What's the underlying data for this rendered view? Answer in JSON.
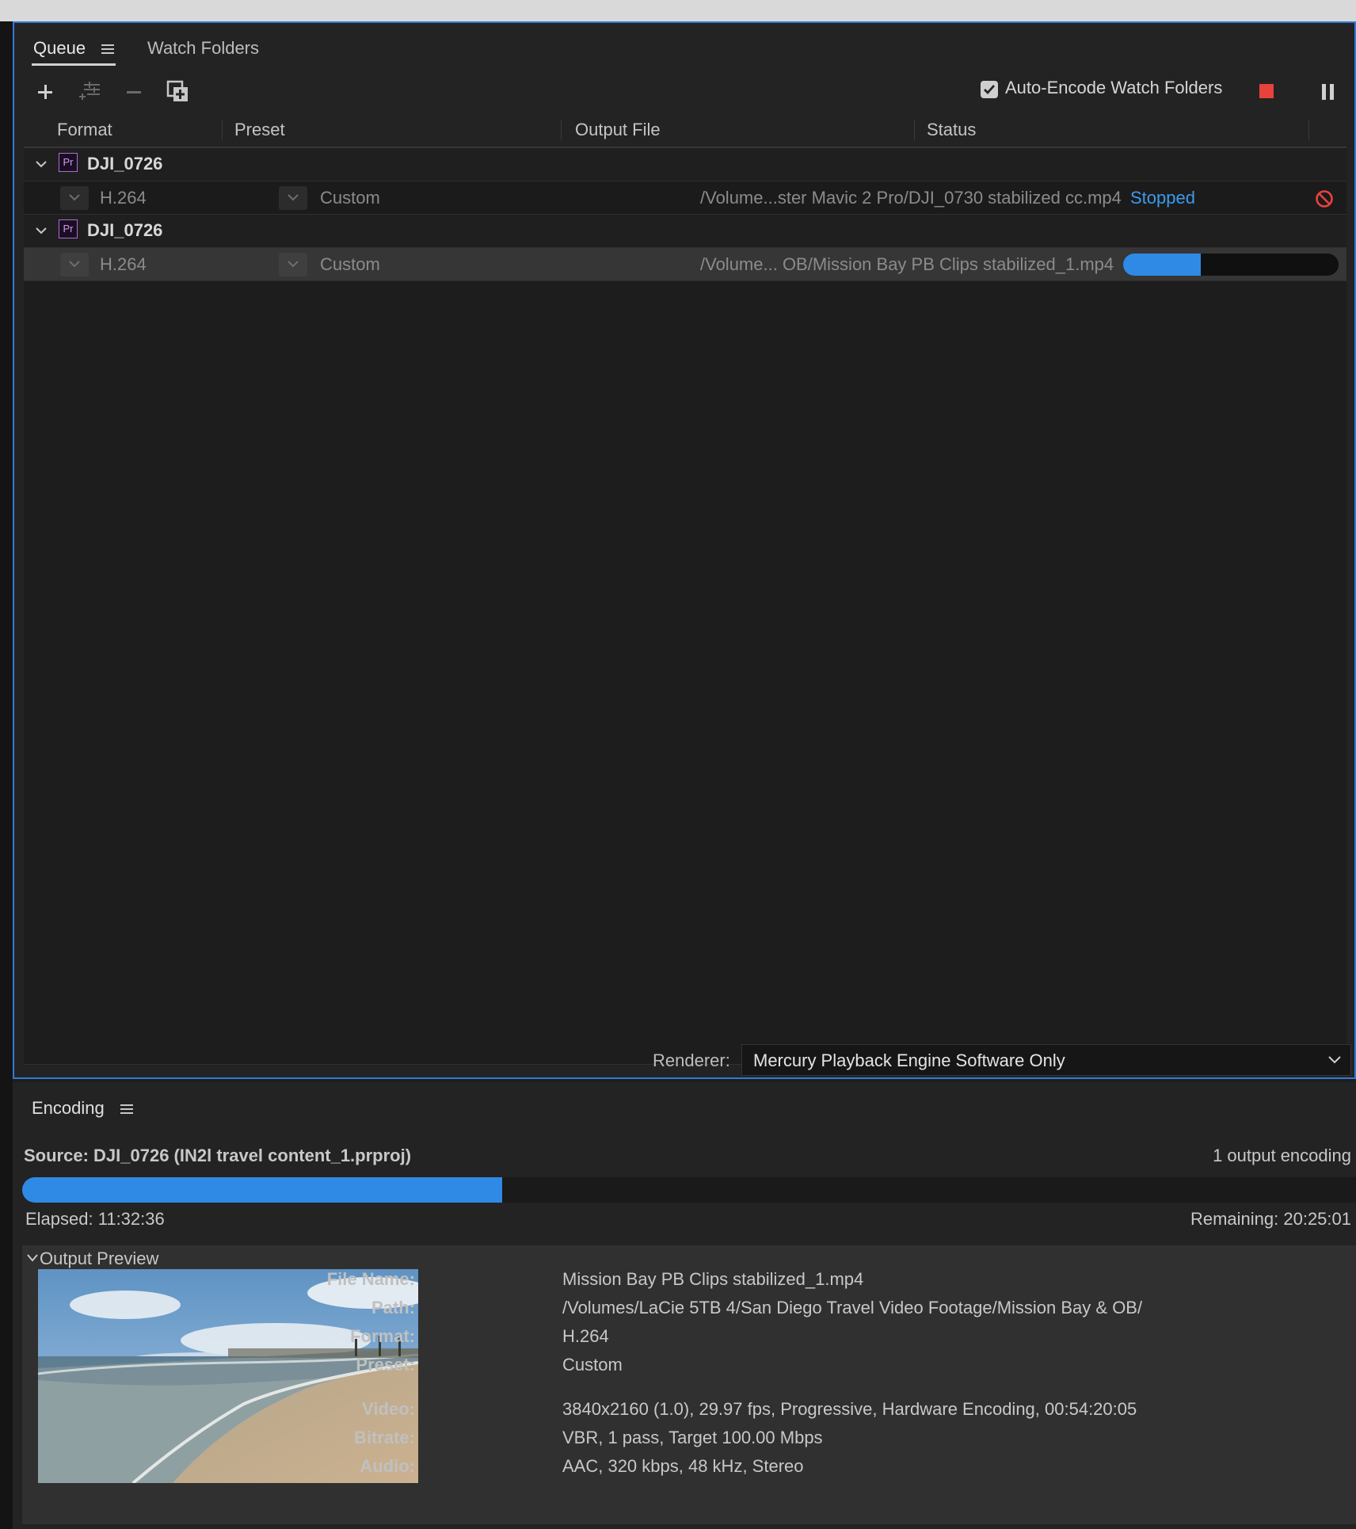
{
  "queue": {
    "tabs": [
      {
        "label": "Queue",
        "active": true
      },
      {
        "label": "Watch Folders",
        "active": false
      }
    ],
    "toolbar": {
      "auto_encode_label": "Auto-Encode Watch Folders",
      "auto_encode_checked": true
    },
    "columns": {
      "format": "Format",
      "preset": "Preset",
      "output_file": "Output File",
      "status": "Status"
    },
    "items": [
      {
        "source": "DJI_0726",
        "output": {
          "format": "H.264",
          "preset": "Custom",
          "file": "/Volume...ster Mavic 2 Pro/DJI_0730 stabilized cc.mp4",
          "status": "Stopped"
        }
      },
      {
        "source": "DJI_0726",
        "output": {
          "format": "H.264",
          "preset": "Custom",
          "file": "/Volume... OB/Mission Bay PB Clips stabilized_1.mp4",
          "progress": 0.36
        }
      }
    ],
    "renderer_label": "Renderer:",
    "renderer_value": "Mercury Playback Engine Software Only",
    "colors": {
      "accent": "#2f8ae6",
      "status_stopped": "#3d9aec",
      "stop_button": "#e8423d",
      "premiere_badge": "#b36ad8"
    }
  },
  "encoding": {
    "tab_label": "Encoding",
    "source": "Source: DJI_0726 (IN2l travel content_1.prproj)",
    "outputs": "1 output encoding",
    "progress": 0.36,
    "elapsed": "Elapsed: 11:32:36",
    "remaining": "Remaining: 20:25:01",
    "preview_title": "Output Preview",
    "meta": [
      {
        "label": "File Name:",
        "value": "Mission Bay PB Clips stabilized_1.mp4"
      },
      {
        "label": "Path:",
        "value": "/Volumes/LaCie 5TB 4/San Diego Travel Video Footage/Mission Bay & OB/"
      },
      {
        "label": "Format:",
        "value": "H.264"
      },
      {
        "label": "Preset:",
        "value": "Custom"
      },
      {
        "label": "Video:",
        "value": "3840x2160 (1.0), 29.97 fps, Progressive, Hardware Encoding, 00:54:20:05"
      },
      {
        "label": "Bitrate:",
        "value": "VBR, 1 pass, Target 100.00 Mbps"
      },
      {
        "label": "Audio:",
        "value": "AAC, 320 kbps, 48 kHz, Stereo"
      }
    ]
  }
}
